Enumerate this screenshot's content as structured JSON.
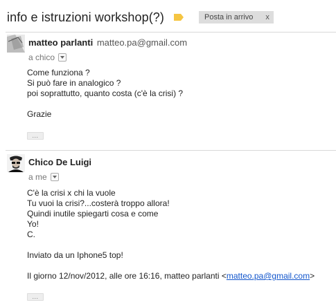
{
  "thread": {
    "subject": "info e istruzioni workshop(?)",
    "label": "Posta in arrivo",
    "label_close": "x"
  },
  "message1": {
    "sender_name": "matteo parlanti",
    "sender_email": "matteo.pa@gmail.com",
    "recipient": "a chico",
    "body": [
      "Come funziona ?",
      "Si può fare in analogico ?",
      "poi soprattutto, quanto costa (c'è la crisi) ?",
      "",
      "Grazie"
    ],
    "ellipsis": "..."
  },
  "message2": {
    "sender_name": "Chico De Luigi",
    "recipient": "a me",
    "body": [
      "C'è la crisi x chi la vuole",
      "Tu vuoi la crisi?...costerà troppo allora!",
      "Quindi inutile spiegarti cosa e come",
      "Yo!",
      "C.",
      "",
      "Inviato da un Iphone5 top!"
    ],
    "quote_prefix": "Il giorno 12/nov/2012, alle ore 16:16, matteo parlanti <",
    "quote_email": "matteo.pa@gmail.com",
    "quote_suffix": ">",
    "ellipsis": "..."
  },
  "colors": {
    "label_tag": "#f5c542",
    "link": "#1155cc",
    "chip_bg": "#dddddd"
  },
  "icons": {
    "label": "label-tag-icon",
    "dropdown": "chevron-down-icon",
    "avatar1": "person-photo-icon",
    "avatar2": "person-photo-icon"
  }
}
